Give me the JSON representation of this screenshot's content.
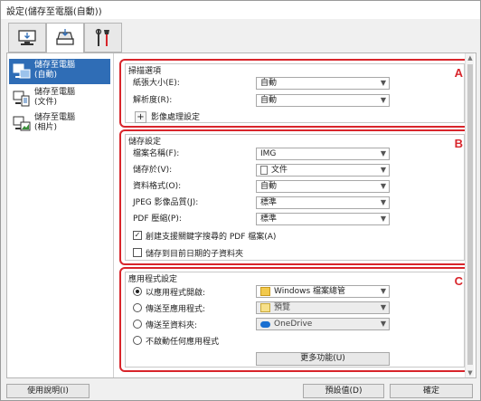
{
  "window": {
    "title": "設定(儲存至電腦(自動))"
  },
  "tabs": [
    {
      "name": "scan-from-computer-tab",
      "icon": "computer-scan-icon",
      "active": false
    },
    {
      "name": "scan-from-panel-tab",
      "icon": "scanner-icon",
      "active": true
    },
    {
      "name": "general-settings-tab",
      "icon": "tools-icon",
      "active": false
    }
  ],
  "sidebar": {
    "items": [
      {
        "label_line1": "儲存至電腦",
        "label_line2": "(自動)",
        "icon": "save-auto-icon",
        "selected": true
      },
      {
        "label_line1": "儲存至電腦",
        "label_line2": "(文件)",
        "icon": "save-document-icon",
        "selected": false
      },
      {
        "label_line1": "儲存至電腦",
        "label_line2": "(相片)",
        "icon": "save-photo-icon",
        "selected": false
      }
    ]
  },
  "scan_options": {
    "title": "掃描選項",
    "letter": "A",
    "paper_size_label": "紙張大小(E):",
    "paper_size_value": "自動",
    "resolution_label": "解析度(R):",
    "resolution_value": "自動",
    "image_processing_label": "影像處理設定",
    "expand_symbol": "+"
  },
  "save_settings": {
    "title": "儲存設定",
    "letter": "B",
    "file_name_label": "檔案名稱(F):",
    "file_name_value": "IMG",
    "save_in_label": "儲存於(V):",
    "save_in_value": "文件",
    "data_format_label": "資料格式(O):",
    "data_format_value": "自動",
    "jpeg_quality_label": "JPEG 影像品質(J):",
    "jpeg_quality_value": "標準",
    "pdf_compression_label": "PDF 壓縮(P):",
    "pdf_compression_value": "標準",
    "searchable_pdf_label": "創建支援關鍵字搜尋的 PDF 檔案(A)",
    "searchable_pdf_checked": true,
    "subfolder_label": "儲存到目前日期的子資料夾",
    "subfolder_checked": false
  },
  "app_settings": {
    "title": "應用程式設定",
    "letter": "C",
    "open_with_label": "以應用程式開啟:",
    "open_with_value": "Windows 檔案總管",
    "open_with_selected": true,
    "send_app_label": "傳送至應用程式:",
    "send_app_value": "預覽",
    "send_folder_label": "傳送至資料夾:",
    "send_folder_value": "OneDrive",
    "no_app_label": "不啟動任何應用程式",
    "more_functions_label": "更多功能(U)"
  },
  "footer": {
    "help_label": "使用說明(I)",
    "defaults_label": "預設值(D)",
    "ok_label": "確定"
  },
  "colors": {
    "accent_red": "#d8252b",
    "selection_blue": "#2f6db6"
  }
}
